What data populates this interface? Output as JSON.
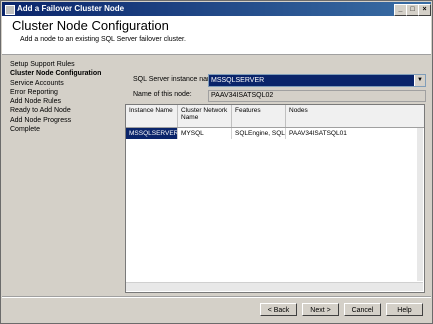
{
  "window": {
    "title": "Add a Failover Cluster Node",
    "min": "_",
    "max": "□",
    "close": "×"
  },
  "header": {
    "title": "Cluster Node Configuration",
    "subtitle": "Add a node to an existing SQL Server failover cluster."
  },
  "nav": {
    "items": [
      {
        "label": "Setup Support Rules",
        "active": false
      },
      {
        "label": "Cluster Node Configuration",
        "active": true
      },
      {
        "label": "Service Accounts",
        "active": false
      },
      {
        "label": "Error Reporting",
        "active": false
      },
      {
        "label": "Add Node Rules",
        "active": false
      },
      {
        "label": "Ready to Add Node",
        "active": false
      },
      {
        "label": "Add Node Progress",
        "active": false
      },
      {
        "label": "Complete",
        "active": false
      }
    ]
  },
  "form": {
    "instance_label": "SQL Server instance name:",
    "instance_value": "MSSQLSERVER",
    "node_label": "Name of this node:",
    "node_value": "PAAV34ISATSQL02"
  },
  "grid": {
    "headers": [
      "Instance Name",
      "Cluster Network Name",
      "Features",
      "Nodes"
    ],
    "rows": [
      [
        "MSSQLSERVER",
        "MYSQL",
        "SQLEngine, SQL...",
        "PAAV34ISATSQL01"
      ]
    ]
  },
  "buttons": {
    "back": "< Back",
    "next": "Next >",
    "cancel": "Cancel",
    "help": "Help"
  },
  "colors": {
    "selection": "#0a246a",
    "titlebar": "#0a246a",
    "face": "#d4d0c8"
  }
}
